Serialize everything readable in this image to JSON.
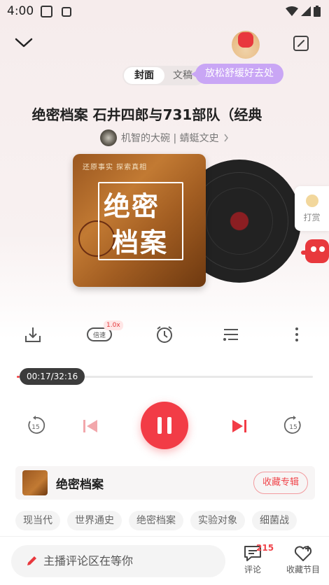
{
  "status_bar": {
    "time": "4:00"
  },
  "tabs": {
    "cover": "封面",
    "text": "文稿"
  },
  "tooltip": "放松舒缓好去处",
  "track": {
    "title": "绝密档案 石井四郎与731部队（经典",
    "author": "机智的大碗 | 蜻蜓文史"
  },
  "cover": {
    "top_text": "还原事实 探索真相",
    "title_line1": "绝密",
    "title_line2": "档案"
  },
  "reward": "打赏",
  "toolbar": {
    "speed_label": "倍速",
    "speed_badge": "1.0x"
  },
  "player": {
    "time_display": "00:17/32:16",
    "progress": 0.009,
    "skip_back_seconds": "15",
    "skip_forward_seconds": "15"
  },
  "album": {
    "name": "绝密档案",
    "favorite_label": "收藏专辑"
  },
  "tags": [
    "现当代",
    "世界通史",
    "绝密档案",
    "实验对象",
    "细菌战"
  ],
  "bottom": {
    "comment_placeholder": "主播评论区在等你",
    "comment_label": "评论",
    "comment_count": "215",
    "collect_label": "收藏节目"
  },
  "colors": {
    "accent": "#f23c46",
    "tooltip": "#c9a6f5"
  }
}
